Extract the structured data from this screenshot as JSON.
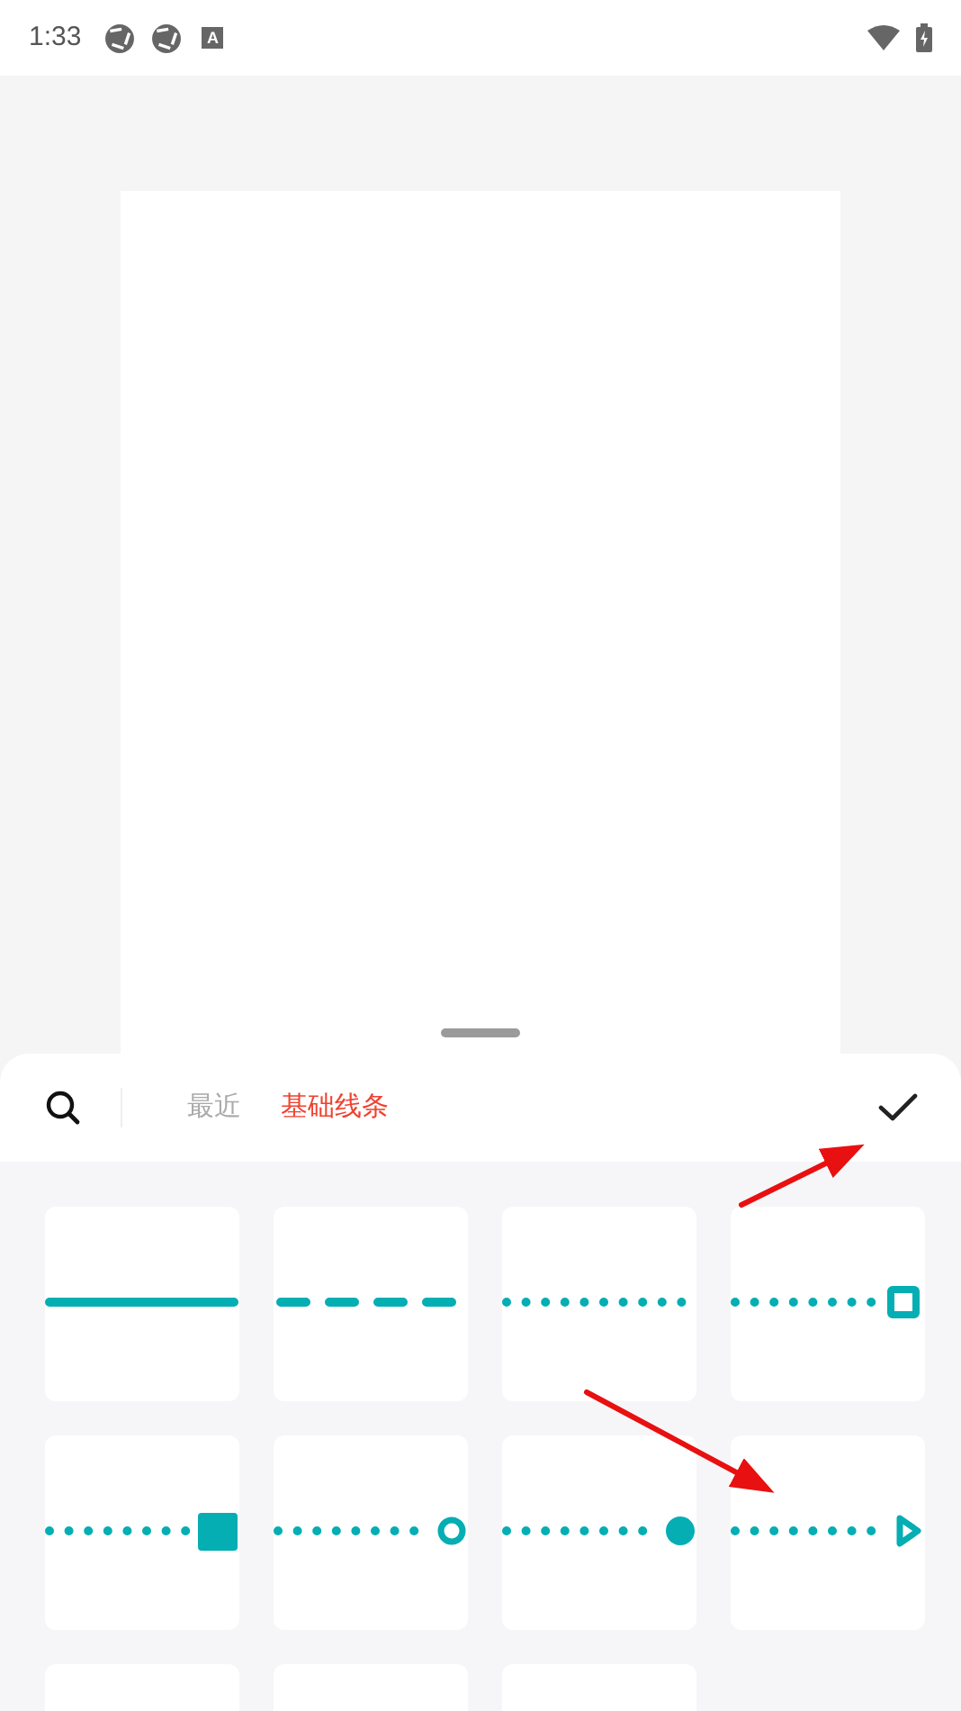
{
  "status_bar": {
    "time": "1:33",
    "badge_letter": "A"
  },
  "sheet": {
    "tabs": [
      {
        "label": "最近",
        "selected": false
      },
      {
        "label": "基础线条",
        "selected": true
      }
    ],
    "line_styles": [
      {
        "kind": "solid"
      },
      {
        "kind": "dashed"
      },
      {
        "kind": "dotted"
      },
      {
        "kind": "hollow_square_end"
      },
      {
        "kind": "square_end"
      },
      {
        "kind": "ring_end"
      },
      {
        "kind": "dot_end"
      },
      {
        "kind": "arrow_end"
      },
      {
        "kind": "empty"
      },
      {
        "kind": "empty"
      },
      {
        "kind": "empty"
      }
    ]
  }
}
